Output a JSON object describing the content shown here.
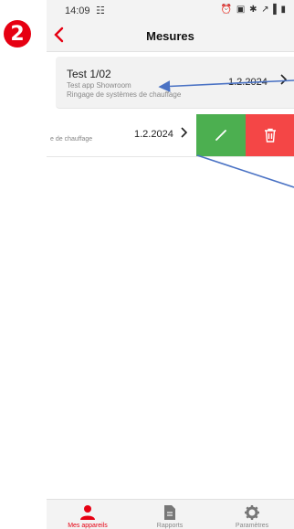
{
  "step": "2",
  "status_bar": {
    "time": "14:09",
    "notification": "☷",
    "icons": "⏰ ▣ ✱ ↗▐ ▮"
  },
  "app_bar": {
    "title": "Mesures"
  },
  "rows": [
    {
      "name": "Test 1/02",
      "line1": "Test app Showroom",
      "line2": "Ringage de systèmes de chauffage",
      "date": "1.2.2024"
    },
    {
      "line1": "",
      "line2": "e de chauffage",
      "date": "1.2.2024"
    }
  ],
  "tabs": [
    {
      "label": "Mes appareils",
      "active": true
    },
    {
      "label": "Rapports",
      "active": false
    },
    {
      "label": "Paramètres",
      "active": false
    }
  ],
  "colors": {
    "accent": "#e60012",
    "edit": "#4caf50",
    "delete": "#f44646",
    "arrow": "#4a72c4"
  },
  "icons": [
    "back-icon",
    "chevron-right-icon",
    "pencil-icon",
    "trash-icon",
    "person-icon",
    "document-icon",
    "gear-icon"
  ]
}
